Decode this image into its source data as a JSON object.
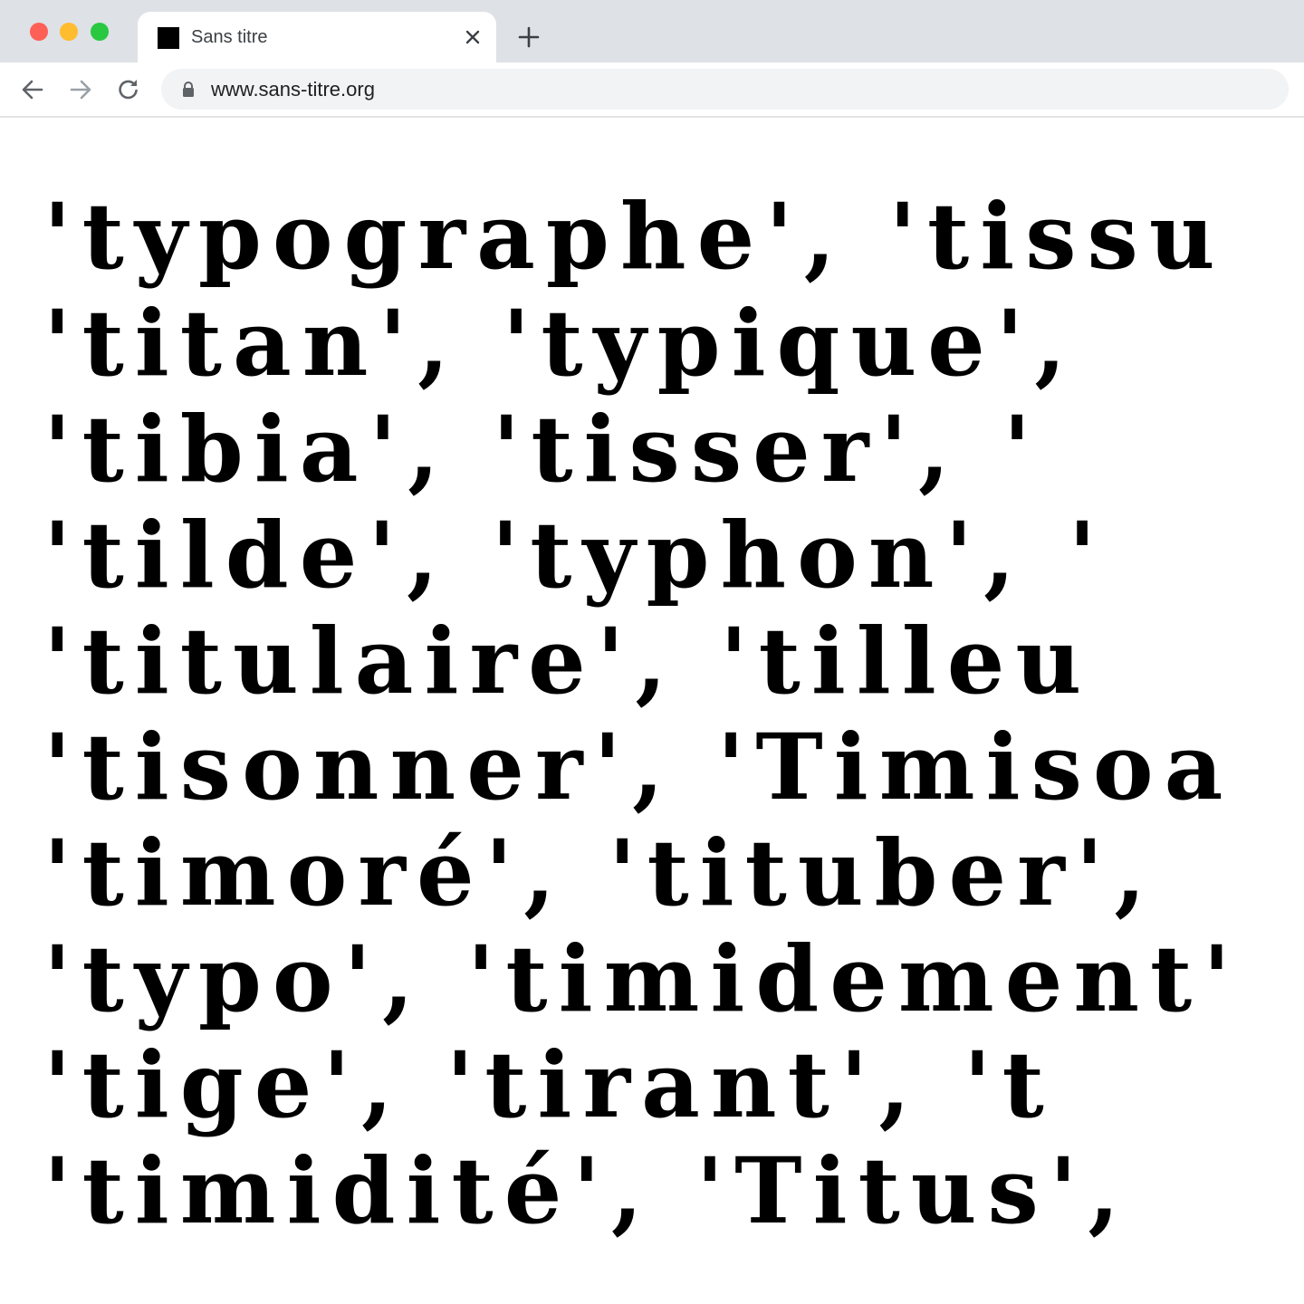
{
  "browser": {
    "tab": {
      "title": "Sans titre",
      "favicon": "black-square-icon"
    },
    "new_tab_icon": "plus-icon",
    "close_icon": "close-icon",
    "nav": {
      "back_icon": "arrow-left-icon",
      "forward_icon": "arrow-right-icon",
      "reload_icon": "reload-icon"
    },
    "address_bar": {
      "lock_icon": "lock-icon",
      "url": "www.sans-titre.org"
    },
    "colors": {
      "tabstrip": "#dee1e6",
      "close_red": "#fe5f57",
      "minimize_yellow": "#febc2e",
      "maximize_green": "#28c840",
      "text": "#000000"
    }
  },
  "page": {
    "lines": [
      "'typographe', 'tissu",
      "'titan', 'typique',",
      "'tibia', 'tisser', '",
      "'tilde', 'typhon', '",
      "'titulaire', 'tilleu",
      "'tisonner', 'Timisoa",
      "'timoré', 'tituber',",
      "'typo', 'timidement'",
      "'tige', 'tirant', 't",
      "'timidité', 'Titus',"
    ]
  }
}
